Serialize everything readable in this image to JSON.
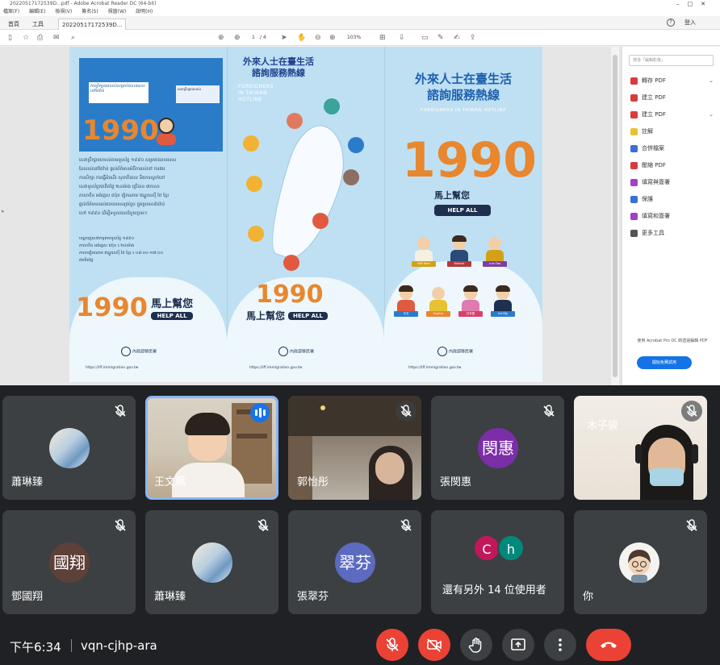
{
  "shared_screen": {
    "window_title": "20220517172539D...pdf - Adobe Acrobat Reader DC (64-bit)",
    "menu": [
      "檔案(F)",
      "編輯(E)",
      "檢視(V)",
      "簽名(S)",
      "視窗(W)",
      "說明(H)"
    ],
    "tabs": [
      "首頁",
      "工具",
      "20220517172539D..."
    ],
    "sign_in": "登入",
    "page_current": "1",
    "page_total": "/ 4",
    "zoom": "103%",
    "right_pane": {
      "search_placeholder": "搜尋「編輯影像」",
      "items": [
        {
          "label": "轉存 PDF",
          "color": "#d93b3b",
          "expand": true
        },
        {
          "label": "建立 PDF",
          "color": "#d93b3b",
          "expand": false
        },
        {
          "label": "建立 PDF",
          "color": "#d93b3b",
          "expand": true
        },
        {
          "label": "註解",
          "color": "#e8c230",
          "expand": false
        },
        {
          "label": "合併檔案",
          "color": "#3a6fd8",
          "expand": false
        },
        {
          "label": "壓縮 PDF",
          "color": "#d93b3b",
          "expand": false
        },
        {
          "label": "填寫與簽署",
          "color": "#a03fc8",
          "expand": false
        },
        {
          "label": "保護",
          "color": "#3a6fd8",
          "expand": false
        },
        {
          "label": "填寫和簽署",
          "color": "#a03fc8",
          "expand": false
        },
        {
          "label": "更多工具",
          "color": "#555555",
          "expand": false
        }
      ],
      "promo": "使用 Acrobat Pro DC 將透過編輯 PDF",
      "trial_button": "開始免費試用"
    },
    "brochure": {
      "p2_title": "外來人士在臺生活\n諮詢服務熱線",
      "p2_subtitle": "FOREIGNERS\nIN TAIWAN\nHOTLINE",
      "p3_title": "外來人士在臺生活\n諮詢服務熱線",
      "p3_subtitle": "FOREIGNERS IN TAIWAN HOTLINE",
      "hotline": "1990",
      "slogan": "馬上幫您",
      "help_all": "HELP ALL",
      "agency": "內政部移民署",
      "lang_tags": [
        "Việt Nam",
        "Bahasa Indonesia",
        "ภาษาไทย",
        "中文",
        "English",
        "日本語",
        "ភាសាខ្មែរ"
      ]
    }
  },
  "participants": [
    {
      "name": "蕭琳臻",
      "type": "photo",
      "muted": true
    },
    {
      "name": "王文珮",
      "type": "video",
      "speaking": true
    },
    {
      "name": "郭怡彤",
      "type": "video",
      "muted": true
    },
    {
      "name": "張閔惠",
      "type": "initials",
      "initials": "閔惠",
      "color": "#7b2ea8",
      "muted": true
    },
    {
      "name": "木子骏",
      "type": "video",
      "muted": true
    },
    {
      "name": "鄧國翔",
      "type": "initials",
      "initials": "國翔",
      "color": "#5d4037",
      "muted": true
    },
    {
      "name": "蕭琳臻",
      "type": "photo",
      "muted": true
    },
    {
      "name": "張翠芬",
      "type": "initials",
      "initials": "翠芬",
      "color": "#5c6bc0",
      "muted": true
    },
    {
      "name": "還有另外 14 位使用者",
      "type": "group",
      "initials": [
        "C",
        "h"
      ],
      "colors": [
        "#c2185b",
        "#00897b"
      ]
    },
    {
      "name": "你",
      "type": "cartoon",
      "muted": true
    }
  ],
  "meeting": {
    "time": "下午6:34",
    "code": "vqn-cjhp-ara"
  },
  "controls": {
    "mic": "mic-off",
    "camera": "camera-off",
    "hand": "raise-hand",
    "present": "present-screen",
    "more": "more-options",
    "leave": "leave-call"
  }
}
